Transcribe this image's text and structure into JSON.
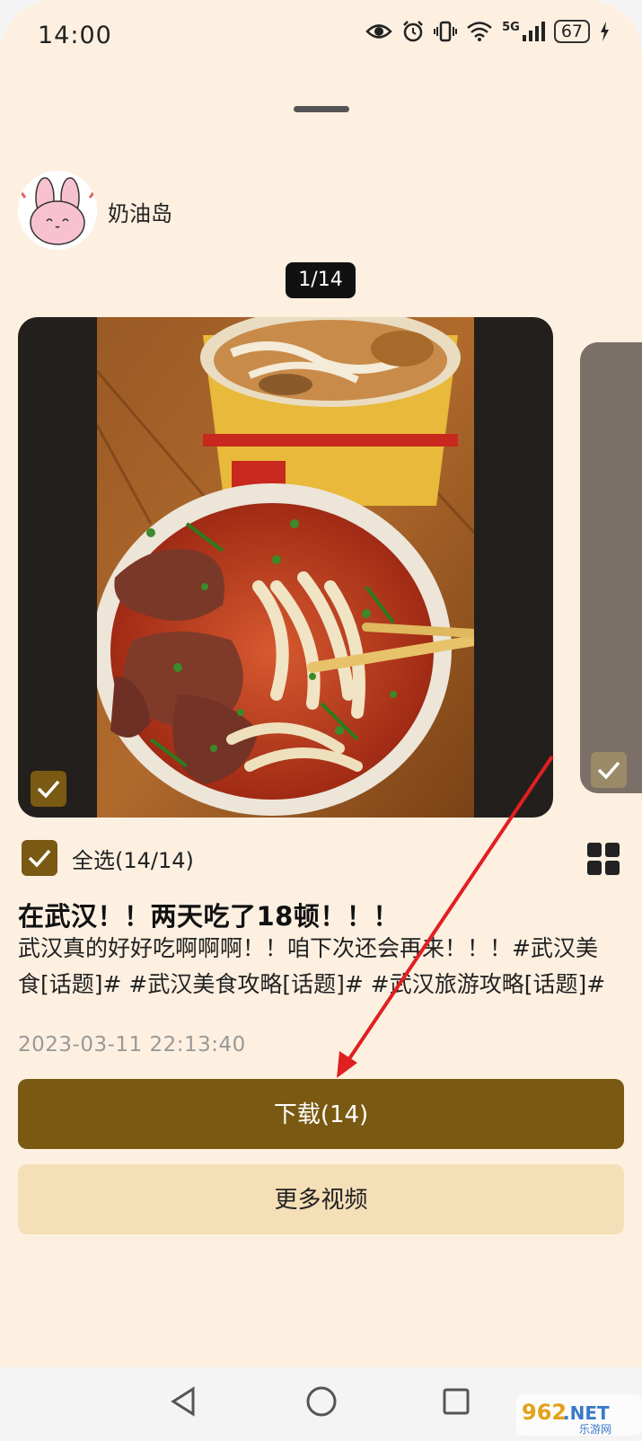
{
  "status_bar": {
    "time": "14:00",
    "battery": "67",
    "network": "5G",
    "icons": [
      "eye-icon",
      "alarm-icon",
      "vibrate-icon",
      "wifi-icon",
      "signal-icon",
      "battery-icon",
      "charging-icon"
    ]
  },
  "profile": {
    "username": "奶油岛",
    "avatar_icon": "bunny-avatar"
  },
  "gallery": {
    "counter": "1/14",
    "current_selected": true
  },
  "select_all": {
    "label": "全选(14/14)",
    "checked": true
  },
  "post": {
    "title": "在武汉！！两天吃了18顿！！！",
    "body": "武汉真的好好吃啊啊啊！！咱下次还会再来！！！#武汉美食[话题]# #武汉美食攻略[话题]# #武汉旅游攻略[话题]#",
    "date": "2023-03-11 22:13:40"
  },
  "buttons": {
    "download": "下载(14)",
    "more_videos": "更多视频"
  },
  "nav": [
    "back-icon",
    "home-icon",
    "recents-icon"
  ],
  "watermark": {
    "brand": "962.NET",
    "sub": "乐游网"
  },
  "colors": {
    "background": "#fdf0e1",
    "accent": "#7a5a12",
    "secondary_button": "#f5dfb7",
    "annotation_arrow": "#e02020"
  }
}
